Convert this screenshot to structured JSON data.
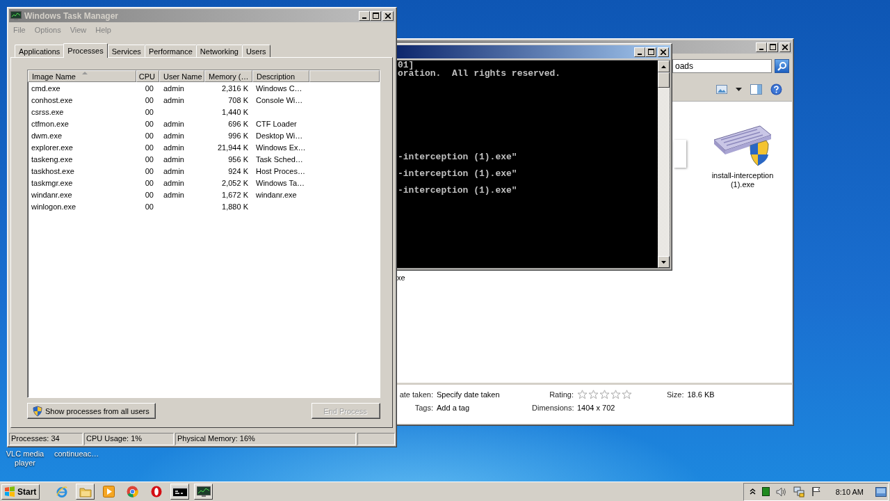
{
  "desktop_icons": [
    {
      "label": "VLC media player"
    },
    {
      "label": "continueac…"
    }
  ],
  "explorer": {
    "address": "oads",
    "file": {
      "label": "install-interception (1).exe"
    },
    "fragment": "xe",
    "details": [
      {
        "label": "ate taken:",
        "value": "Specify date taken"
      },
      {
        "label": "Tags:",
        "value": "Add a tag"
      },
      {
        "label": "Rating:",
        "kind": "stars",
        "stars": 0
      },
      {
        "label": "Dimensions:",
        "value": "1404 x 702"
      },
      {
        "label": "Size:",
        "value": "18.6 KB"
      }
    ]
  },
  "console": {
    "lines": [
      "01]",
      "oration.  All rights reserved.",
      "-interception (1).exe\"",
      "-interception (1).exe\"",
      "-interception (1).exe\""
    ]
  },
  "task_manager": {
    "title": "Windows Task Manager",
    "menu": [
      "File",
      "Options",
      "View",
      "Help"
    ],
    "tabs": [
      {
        "label": "Applications",
        "selected": false
      },
      {
        "label": "Processes",
        "selected": true
      },
      {
        "label": "Services",
        "selected": false
      },
      {
        "label": "Performance",
        "selected": false
      },
      {
        "label": "Networking",
        "selected": false
      },
      {
        "label": "Users",
        "selected": false
      }
    ],
    "columns": [
      {
        "label": "Image Name",
        "sorted": true
      },
      {
        "label": "CPU",
        "sorted": false
      },
      {
        "label": "User Name",
        "sorted": false
      },
      {
        "label": "Memory (…",
        "sorted": false
      },
      {
        "label": "Description",
        "sorted": false
      }
    ],
    "rows": [
      {
        "name": "cmd.exe",
        "cpu": "00",
        "user": "admin",
        "memory": "2,316 K",
        "description": "Windows C…"
      },
      {
        "name": "conhost.exe",
        "cpu": "00",
        "user": "admin",
        "memory": "708 K",
        "description": "Console Wi…"
      },
      {
        "name": "csrss.exe",
        "cpu": "00",
        "memory": "1,440 K"
      },
      {
        "name": "ctfmon.exe",
        "cpu": "00",
        "user": "admin",
        "memory": "696 K",
        "description": "CTF Loader"
      },
      {
        "name": "dwm.exe",
        "cpu": "00",
        "user": "admin",
        "memory": "996 K",
        "description": "Desktop Wi…"
      },
      {
        "name": "explorer.exe",
        "cpu": "00",
        "user": "admin",
        "memory": "21,944 K",
        "description": "Windows Ex…"
      },
      {
        "name": "taskeng.exe",
        "cpu": "00",
        "user": "admin",
        "memory": "956 K",
        "description": "Task Sched…"
      },
      {
        "name": "taskhost.exe",
        "cpu": "00",
        "user": "admin",
        "memory": "924 K",
        "description": "Host Proces…"
      },
      {
        "name": "taskmgr.exe",
        "cpu": "00",
        "user": "admin",
        "memory": "2,052 K",
        "description": "Windows Ta…"
      },
      {
        "name": "windanr.exe",
        "cpu": "00",
        "user": "admin",
        "memory": "1,672 K",
        "description": "windanr.exe"
      },
      {
        "name": "winlogon.exe",
        "cpu": "00",
        "memory": "1,880 K"
      }
    ],
    "show_all_button": "Show processes from all users",
    "end_process": {
      "label": "End Process",
      "disabled": true
    },
    "status": [
      "Processes: 34",
      "CPU Usage: 1%",
      "Physical Memory: 16%"
    ]
  },
  "taskbar": {
    "start": "Start",
    "apps": [
      {
        "kind": "ie",
        "open": false
      },
      {
        "kind": "folder",
        "open": true
      },
      {
        "kind": "media",
        "open": false
      },
      {
        "kind": "chrome",
        "open": false
      },
      {
        "kind": "opera",
        "open": false
      },
      {
        "kind": "console",
        "open": true
      },
      {
        "kind": "taskmgr",
        "open": true
      }
    ],
    "tray": [
      {
        "kind": "chevron"
      },
      {
        "kind": "green"
      },
      {
        "kind": "speaker"
      },
      {
        "kind": "network"
      },
      {
        "kind": "flag"
      }
    ],
    "clock": "8:10 AM"
  }
}
